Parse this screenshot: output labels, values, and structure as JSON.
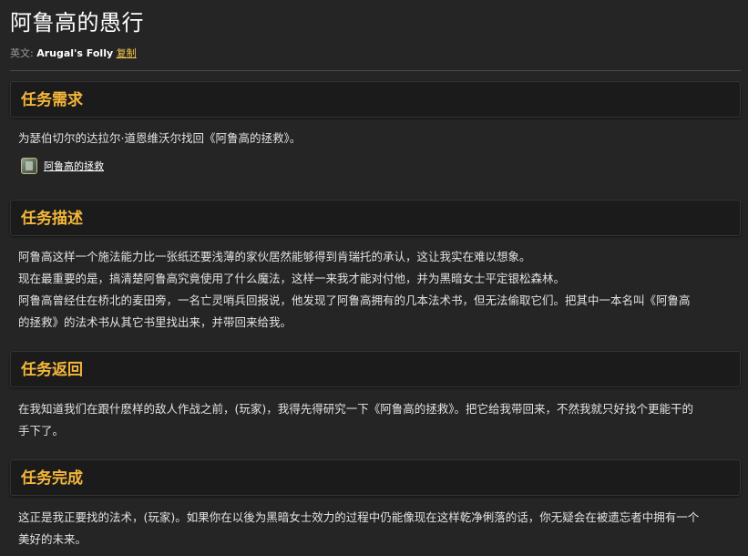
{
  "page": {
    "title": "阿鲁高的愚行",
    "english_label": "英文:",
    "english_name": "Arugal's Folly",
    "copy_label": "复制"
  },
  "requirements": {
    "heading": "任务需求",
    "text": "为瑟伯切尔的达拉尔·道恩维沃尔找回《阿鲁高的拯救》。",
    "item": {
      "icon": "book-icon",
      "name": "阿鲁高的拯救"
    }
  },
  "description": {
    "heading": "任务描述",
    "lines": [
      "阿鲁高这样一个施法能力比一张纸还要浅薄的家伙居然能够得到肯瑞托的承认，这让我实在难以想象。",
      "现在最重要的是，搞清楚阿鲁高究竟使用了什么魔法，这样一来我才能对付他，并为黑暗女士平定银松森林。",
      "阿鲁高曾经住在桥北的麦田旁，一名亡灵哨兵回报说，他发现了阿鲁高拥有的几本法术书，但无法偷取它们。把其中一本名叫《阿鲁高",
      "的拯救》的法术书从其它书里找出来，并带回来给我。"
    ]
  },
  "progress": {
    "heading": "任务返回",
    "lines": [
      "在我知道我们在跟什麽样的敌人作战之前，(玩家)，我得先得研究一下《阿鲁高的拯救》。把它给我带回来，不然我就只好找个更能干的",
      "手下了。"
    ]
  },
  "completion": {
    "heading": "任务完成",
    "lines": [
      "这正是我正要找的法术，(玩家)。如果你在以後为黑暗女士效力的过程中仍能像现在这样乾净俐落的话，你无疑会在被遗忘者中拥有一个",
      "美好的未来。"
    ]
  }
}
